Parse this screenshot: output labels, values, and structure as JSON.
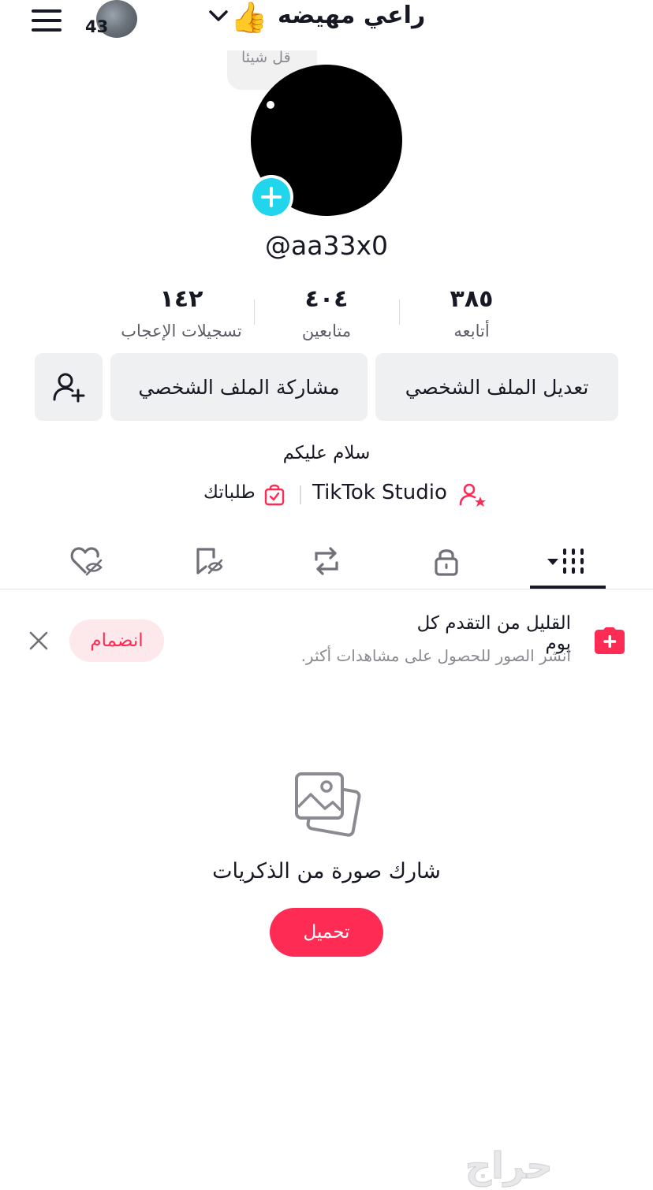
{
  "header": {
    "story_count": "43",
    "display_name": "راعي مهيضه",
    "name_emoji": "👍"
  },
  "profile": {
    "thought_placeholder": "قل شيئا",
    "username": "@aa33x0",
    "bio": "سلام عليكم"
  },
  "stats": [
    {
      "value": "٣٨٥",
      "label": "أتابعه"
    },
    {
      "value": "٤٠٤",
      "label": "متابعين"
    },
    {
      "value": "١٤٢",
      "label": "تسجيلات الإعجاب"
    }
  ],
  "buttons": {
    "edit_profile": "تعديل الملف الشخصي",
    "share_profile": "مشاركة الملف الشخصي"
  },
  "links": {
    "studio": "TikTok Studio",
    "orders": "طلباتك"
  },
  "tabs": [
    {
      "icon": "grid-icon",
      "active": true
    },
    {
      "icon": "lock-icon",
      "active": false
    },
    {
      "icon": "repost-icon",
      "active": false
    },
    {
      "icon": "bookmark-hidden-icon",
      "active": false
    },
    {
      "icon": "heart-hidden-icon",
      "active": false
    }
  ],
  "banner": {
    "title": "القليل من التقدم كل يوم",
    "subtitle": "انشر الصور للحصول على مشاهدات أكثر.",
    "join_label": "انضمام"
  },
  "empty_state": {
    "title": "شارك صورة من الذكريات",
    "upload_label": "تحميل"
  },
  "watermark": "حراج",
  "colors": {
    "accent": "#fe2c55",
    "avatar_add": "#20d5ec",
    "button_bg": "#eff0f1",
    "text": "#161823",
    "muted": "#8a8b91"
  }
}
